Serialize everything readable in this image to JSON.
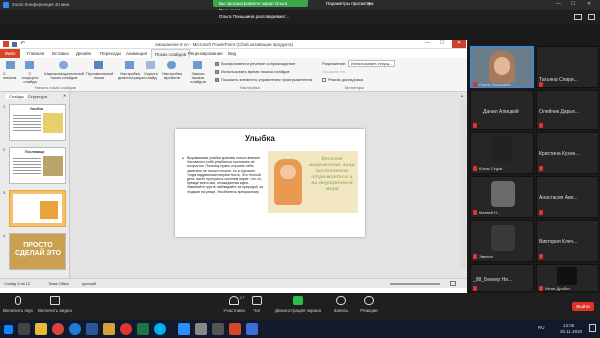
{
  "zoom": {
    "title": "Zoom Конференция 40 мин",
    "green_status": "Вы просматриваете экран Ольга Поньшина",
    "view_options": "Параметры просмотра",
    "share_banner": "Ольга Поньшина разговаривает..."
  },
  "ppt": {
    "window_title": "смешанное 8 кл - Microsoft PowerPoint (Сбой активации продукта)",
    "tabs": [
      "Файл",
      "Главная",
      "Вставка",
      "Дизайн",
      "Переходы",
      "Анимация",
      "Показ слайдов",
      "Рецензирование",
      "Вид"
    ],
    "ribbon": {
      "btn_start": "С начала",
      "btn_current": "С текущего слайда",
      "btn_broadcast": "Широковещательный показ слайдов",
      "btn_custom": "Произвольный показ",
      "btn_setup": "Настройка демонстрации",
      "btn_hide": "Скрыть слайд",
      "btn_rehearse": "Настройка времени",
      "btn_record": "Запись показа слайдов",
      "group_start": "Начать показ слайдов",
      "group_setup": "Настройка",
      "group_monitors": "Мониторы",
      "chk_narration": "Воспроизвести речевое сопровождение",
      "chk_timings": "Использовать время показа слайдов",
      "chk_media": "Показать элементы управления проигрывателем",
      "resolution_label": "Разрешение:",
      "resolution_value": "Использовать текущ...",
      "show_on_label": "Показать на:",
      "presenter_view": "Режим докладчика"
    },
    "pane_tabs": [
      "Слайды",
      "Структура"
    ],
    "slides": [
      {
        "num": "1",
        "title": "Улыбка"
      },
      {
        "num": "2",
        "title": "Пословица"
      },
      {
        "num": "3",
        "title": "",
        "selected": true
      },
      {
        "num": "4",
        "title": "ПРОСТО СДЕЛАЙ ЭТО"
      }
    ],
    "slide": {
      "title": "Улыбка",
      "bullet": "Выражаемая улыбка красива только внешне. Заставлять себя улыбаться постоянно не получится. Поэтому нужно слушать себя, замечать не только плохое, но и хорошее. Тогда надуманная неприятность. Это теплый день после прогулки в осеннем парке. Что-то, прежде всего вас, неожиданная идея. Заменяйте грусть наблюдайте за природой, за людьми на улице. Улыбнитесь прекрасному.",
      "image_text": "Веселое выражение лица постепенно отражается и на внутреннем мире"
    },
    "status": {
      "slide": "Слайд 3 из 12",
      "theme": "Тема Office",
      "lang": "русский"
    }
  },
  "gallery": [
    {
      "name": "Ольга Поньшина",
      "video": true
    },
    {
      "name": "Татьяна Спири..."
    },
    {
      "name": "Данил Алицкий"
    },
    {
      "name": "Олейник Дарья..."
    },
    {
      "name": "Юлия Стурж"
    },
    {
      "name": "Кристина Кузне..."
    },
    {
      "name": "Матвей Н..."
    },
    {
      "name": "Анастасия Аве..."
    },
    {
      "name": "Эвелин"
    },
    {
      "name": "Виктория Клеч..."
    },
    {
      "name": "_98_Беккер Ни..."
    },
    {
      "name": "Игнат Дробот"
    }
  ],
  "toolbar": {
    "mic": "Включить звук",
    "video": "Включить видео",
    "participants": "Участники",
    "participants_count": "27",
    "chat": "Чат",
    "share": "Демонстрация экрана",
    "record": "Запись",
    "reactions": "Реакции",
    "leave": "Выйти"
  },
  "taskbar": {
    "lang": "RU",
    "time": "13:05",
    "date": "30.11.2020"
  },
  "colors": {
    "zoom_green": "#3aa64a",
    "leave_red": "#e0302a",
    "share_green": "#2dbd4a",
    "ppt_orange": "#d24726"
  }
}
